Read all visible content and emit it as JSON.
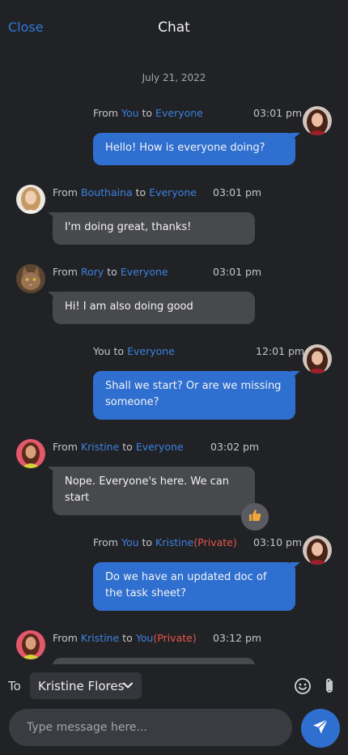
{
  "header": {
    "close_label": "Close",
    "title": "Chat"
  },
  "feed": {
    "date": "July 21, 2022",
    "messages": [
      {
        "from_prefix": "From",
        "sender": "You",
        "to_word": "to",
        "recipient": "Everyone",
        "private": "",
        "time": "03:01 pm",
        "text": "Hello! How is everyone doing?",
        "avatar": "avatar-you-icon"
      },
      {
        "from_prefix": "From",
        "sender": "Bouthaina",
        "to_word": "to",
        "recipient": "Everyone",
        "private": "",
        "time": "03:01 pm",
        "text": "I'm doing great, thanks!",
        "avatar": "avatar-bouthaina-icon"
      },
      {
        "from_prefix": "From",
        "sender": "Rory",
        "to_word": "to",
        "recipient": "Everyone",
        "private": "",
        "time": "03:01 pm",
        "text": "Hi! I am also doing good",
        "avatar": "avatar-rory-icon"
      },
      {
        "from_prefix": "",
        "sender": "You",
        "to_word": "to",
        "recipient": "Everyone",
        "private": "",
        "time": "12:01 pm",
        "text": "Shall we start? Or are we missing someone?",
        "avatar": "avatar-you-icon"
      },
      {
        "from_prefix": "From",
        "sender": "Kristine",
        "to_word": "to",
        "recipient": "Everyone",
        "private": "",
        "time": "03:02 pm",
        "text": "Nope. Everyone's here. We can start",
        "avatar": "avatar-kristine-icon",
        "reaction": "thumbs-up-icon"
      },
      {
        "from_prefix": "From",
        "sender": "You",
        "to_word": "to",
        "recipient": "Kristine",
        "private": "(Private)",
        "time": "03:10 pm",
        "text": "Do we have an updated doc of the task sheet?",
        "avatar": "avatar-you-icon"
      },
      {
        "from_prefix": "From",
        "sender": "Kristine",
        "to_word": "to",
        "recipient": "You",
        "private": "(Private)",
        "time": "03:12 pm",
        "text": "",
        "avatar": "avatar-kristine-icon"
      }
    ]
  },
  "composer": {
    "to_label": "To",
    "recipient_value": "Kristine Flores",
    "placeholder": "Type message here...",
    "emoji_icon": "emoji-icon",
    "attach_icon": "paperclip-icon",
    "send_icon": "send-icon"
  },
  "colors": {
    "accent": "#2f6fcf",
    "link": "#3c82e0",
    "private": "#e8564a",
    "background": "#212226",
    "received": "#48494d"
  }
}
